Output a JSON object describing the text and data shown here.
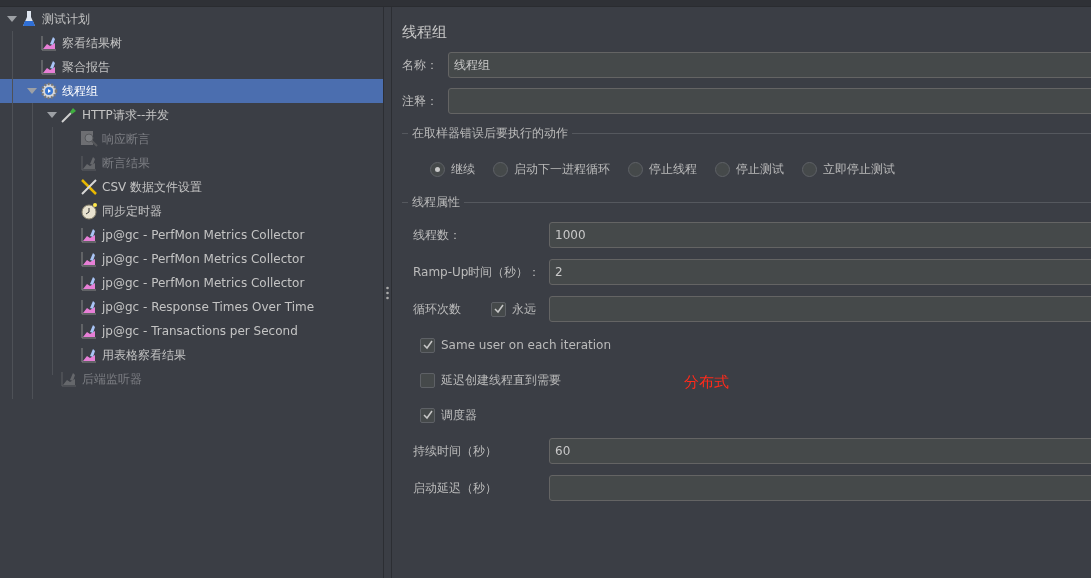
{
  "tree": [
    {
      "label": "测试计划",
      "kind": "flask",
      "expanded": true,
      "selected": false,
      "disabled": false,
      "children": [
        {
          "label": "察看结果树",
          "kind": "graph",
          "selected": false,
          "disabled": false
        },
        {
          "label": "聚合报告",
          "kind": "graph",
          "selected": false,
          "disabled": false
        },
        {
          "label": "线程组",
          "kind": "gear",
          "expanded": true,
          "selected": true,
          "disabled": false,
          "children": [
            {
              "label": "HTTP请求--并发",
              "kind": "dropper",
              "expanded": true,
              "selected": false,
              "disabled": false,
              "children": [
                {
                  "label": "响应断言",
                  "kind": "magnifier",
                  "selected": false,
                  "disabled": true
                },
                {
                  "label": "断言结果",
                  "kind": "graph",
                  "selected": false,
                  "disabled": true
                },
                {
                  "label": "CSV 数据文件设置",
                  "kind": "wrench",
                  "selected": false,
                  "disabled": false
                },
                {
                  "label": "同步定时器",
                  "kind": "timer",
                  "selected": false,
                  "disabled": false
                },
                {
                  "label": "jp@gc - PerfMon Metrics Collector",
                  "kind": "graph",
                  "selected": false,
                  "disabled": false
                },
                {
                  "label": "jp@gc - PerfMon Metrics Collector",
                  "kind": "graph",
                  "selected": false,
                  "disabled": false
                },
                {
                  "label": "jp@gc - PerfMon Metrics Collector",
                  "kind": "graph",
                  "selected": false,
                  "disabled": false
                },
                {
                  "label": "jp@gc - Response Times Over Time",
                  "kind": "graph",
                  "selected": false,
                  "disabled": false
                },
                {
                  "label": "jp@gc - Transactions per Second",
                  "kind": "graph",
                  "selected": false,
                  "disabled": false
                },
                {
                  "label": "用表格察看结果",
                  "kind": "graph",
                  "selected": false,
                  "disabled": false
                }
              ]
            },
            {
              "label": "后端监听器",
              "kind": "graph",
              "selected": false,
              "disabled": true
            }
          ]
        }
      ]
    }
  ],
  "editor": {
    "title": "线程组",
    "name": {
      "label": "名称：",
      "value": "线程组"
    },
    "comment": {
      "label": "注释："
    },
    "error_action": {
      "legend": "在取样器错误后要执行的动作",
      "options": [
        {
          "label": "继续",
          "selected": true
        },
        {
          "label": "启动下一进程循环",
          "selected": false
        },
        {
          "label": "停止线程",
          "selected": false
        },
        {
          "label": "停止测试",
          "selected": false
        },
        {
          "label": "立即停止测试",
          "selected": false
        }
      ]
    },
    "thread_properties": {
      "legend": "线程属性",
      "rows": [
        {
          "kind": "field",
          "label": "线程数：",
          "value": "1000"
        },
        {
          "kind": "field",
          "label": "Ramp-Up时间（秒）：",
          "value": "2"
        },
        {
          "kind": "loop",
          "label": "循环次数",
          "option": {
            "label": "永远",
            "checked": true
          }
        },
        {
          "kind": "checkbox",
          "label": "Same user on each iteration",
          "checked": true
        },
        {
          "kind": "checkbox",
          "label": "延迟创建线程直到需要",
          "checked": false,
          "note": "分布式"
        },
        {
          "kind": "checkbox",
          "label": "调度器",
          "checked": true
        },
        {
          "kind": "field",
          "label": "持续时间（秒）",
          "value": "60"
        },
        {
          "kind": "field",
          "label": "启动延迟（秒）"
        }
      ]
    }
  }
}
